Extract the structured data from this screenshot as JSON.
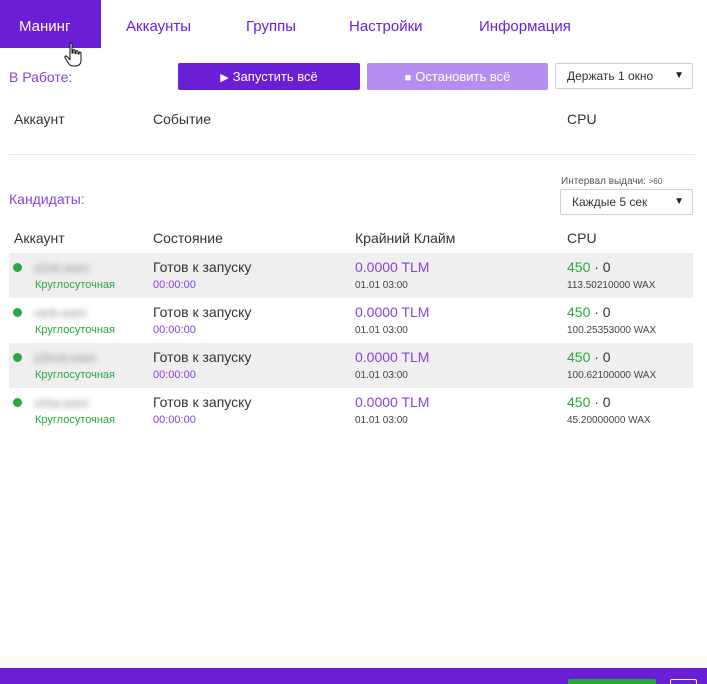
{
  "tabs": [
    {
      "label": "Манинг",
      "active": true
    },
    {
      "label": "Аккаунты"
    },
    {
      "label": "Группы"
    },
    {
      "label": "Настройки"
    },
    {
      "label": "Информация"
    }
  ],
  "work": {
    "label": "В Работе:",
    "start_label": "Запустить всё",
    "stop_label": "Остановить всё",
    "window_select": "Держать 1 окно",
    "columns": {
      "account": "Аккаунт",
      "event": "Событие",
      "cpu": "CPU"
    }
  },
  "candidates": {
    "label": "Кандидаты:",
    "interval_caption": "Интервал выдачи:",
    "interval_caption_small": ">60",
    "interval_select": "Каждые 5 сек",
    "columns": {
      "account": "Аккаунт",
      "state": "Состояние",
      "claim": "Крайний Клайм",
      "cpu": "CPU"
    },
    "rows": [
      {
        "account": "a2eb.wam",
        "mode": "Круглосуточная",
        "state": "Готов к запуску",
        "timer": "00:00:00",
        "tlm": "0.0000 TLM",
        "date": "01.01 03:00",
        "cpu_green": "450",
        "cpu_rest": " · 0",
        "wax": "113.50210000 WAX"
      },
      {
        "account": "rqnb.wam",
        "mode": "Круглосуточная",
        "state": "Готов к запуску",
        "timer": "00:00:00",
        "tlm": "0.0000 TLM",
        "date": "01.01 03:00",
        "cpu_green": "450",
        "cpu_rest": " · 0",
        "wax": "100.25353000 WAX"
      },
      {
        "account": "a3hnb.wam",
        "mode": "Круглосуточная",
        "state": "Готов к запуску",
        "timer": "00:00:00",
        "tlm": "0.0000 TLM",
        "date": "01.01 03:00",
        "cpu_green": "450",
        "cpu_rest": " · 0",
        "wax": "100.62100000 WAX"
      },
      {
        "account": "zirbg.wam",
        "mode": "Круглосуточная",
        "state": "Готов к запуску",
        "timer": "00:00:00",
        "tlm": "0.0000 TLM",
        "date": "01.01 03:00",
        "cpu_green": "450",
        "cpu_rest": " · 0",
        "wax": "45.20000000 WAX"
      }
    ]
  },
  "colors": {
    "accent": "#6a1fd6",
    "accent_light": "#b48ff0",
    "text_purple": "#8a3fe0",
    "status_green": "#27a83e"
  },
  "icons": {
    "start": "play-icon",
    "stop": "stop-icon",
    "dropdown": "chevron-down-icon",
    "status": "status-dot-icon",
    "cursor": "hand-pointer-icon"
  }
}
